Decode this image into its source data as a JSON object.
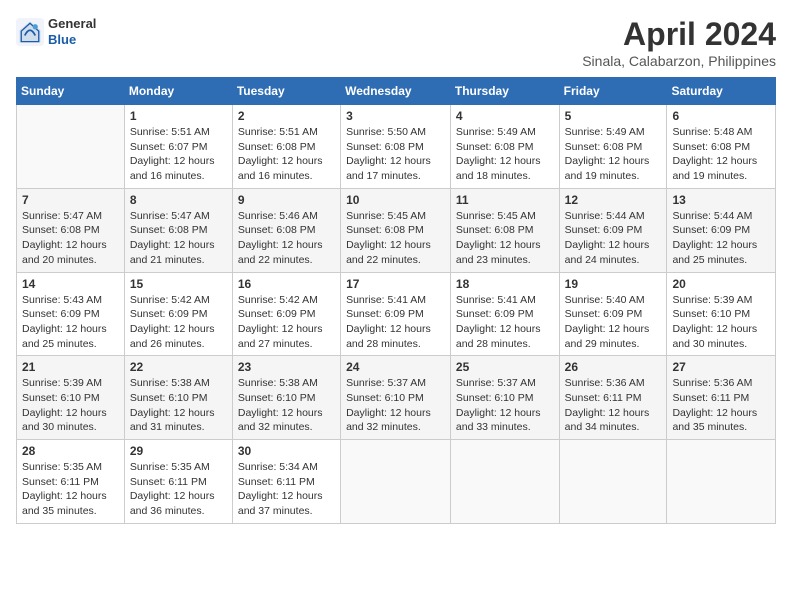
{
  "header": {
    "logo": {
      "general": "General",
      "blue": "Blue"
    },
    "title": "April 2024",
    "subtitle": "Sinala, Calabarzon, Philippines"
  },
  "calendar": {
    "days_of_week": [
      "Sunday",
      "Monday",
      "Tuesday",
      "Wednesday",
      "Thursday",
      "Friday",
      "Saturday"
    ],
    "weeks": [
      [
        {
          "day": "",
          "info": ""
        },
        {
          "day": "1",
          "info": "Sunrise: 5:51 AM\nSunset: 6:07 PM\nDaylight: 12 hours\nand 16 minutes."
        },
        {
          "day": "2",
          "info": "Sunrise: 5:51 AM\nSunset: 6:08 PM\nDaylight: 12 hours\nand 16 minutes."
        },
        {
          "day": "3",
          "info": "Sunrise: 5:50 AM\nSunset: 6:08 PM\nDaylight: 12 hours\nand 17 minutes."
        },
        {
          "day": "4",
          "info": "Sunrise: 5:49 AM\nSunset: 6:08 PM\nDaylight: 12 hours\nand 18 minutes."
        },
        {
          "day": "5",
          "info": "Sunrise: 5:49 AM\nSunset: 6:08 PM\nDaylight: 12 hours\nand 19 minutes."
        },
        {
          "day": "6",
          "info": "Sunrise: 5:48 AM\nSunset: 6:08 PM\nDaylight: 12 hours\nand 19 minutes."
        }
      ],
      [
        {
          "day": "7",
          "info": "Sunrise: 5:47 AM\nSunset: 6:08 PM\nDaylight: 12 hours\nand 20 minutes."
        },
        {
          "day": "8",
          "info": "Sunrise: 5:47 AM\nSunset: 6:08 PM\nDaylight: 12 hours\nand 21 minutes."
        },
        {
          "day": "9",
          "info": "Sunrise: 5:46 AM\nSunset: 6:08 PM\nDaylight: 12 hours\nand 22 minutes."
        },
        {
          "day": "10",
          "info": "Sunrise: 5:45 AM\nSunset: 6:08 PM\nDaylight: 12 hours\nand 22 minutes."
        },
        {
          "day": "11",
          "info": "Sunrise: 5:45 AM\nSunset: 6:08 PM\nDaylight: 12 hours\nand 23 minutes."
        },
        {
          "day": "12",
          "info": "Sunrise: 5:44 AM\nSunset: 6:09 PM\nDaylight: 12 hours\nand 24 minutes."
        },
        {
          "day": "13",
          "info": "Sunrise: 5:44 AM\nSunset: 6:09 PM\nDaylight: 12 hours\nand 25 minutes."
        }
      ],
      [
        {
          "day": "14",
          "info": "Sunrise: 5:43 AM\nSunset: 6:09 PM\nDaylight: 12 hours\nand 25 minutes."
        },
        {
          "day": "15",
          "info": "Sunrise: 5:42 AM\nSunset: 6:09 PM\nDaylight: 12 hours\nand 26 minutes."
        },
        {
          "day": "16",
          "info": "Sunrise: 5:42 AM\nSunset: 6:09 PM\nDaylight: 12 hours\nand 27 minutes."
        },
        {
          "day": "17",
          "info": "Sunrise: 5:41 AM\nSunset: 6:09 PM\nDaylight: 12 hours\nand 28 minutes."
        },
        {
          "day": "18",
          "info": "Sunrise: 5:41 AM\nSunset: 6:09 PM\nDaylight: 12 hours\nand 28 minutes."
        },
        {
          "day": "19",
          "info": "Sunrise: 5:40 AM\nSunset: 6:09 PM\nDaylight: 12 hours\nand 29 minutes."
        },
        {
          "day": "20",
          "info": "Sunrise: 5:39 AM\nSunset: 6:10 PM\nDaylight: 12 hours\nand 30 minutes."
        }
      ],
      [
        {
          "day": "21",
          "info": "Sunrise: 5:39 AM\nSunset: 6:10 PM\nDaylight: 12 hours\nand 30 minutes."
        },
        {
          "day": "22",
          "info": "Sunrise: 5:38 AM\nSunset: 6:10 PM\nDaylight: 12 hours\nand 31 minutes."
        },
        {
          "day": "23",
          "info": "Sunrise: 5:38 AM\nSunset: 6:10 PM\nDaylight: 12 hours\nand 32 minutes."
        },
        {
          "day": "24",
          "info": "Sunrise: 5:37 AM\nSunset: 6:10 PM\nDaylight: 12 hours\nand 32 minutes."
        },
        {
          "day": "25",
          "info": "Sunrise: 5:37 AM\nSunset: 6:10 PM\nDaylight: 12 hours\nand 33 minutes."
        },
        {
          "day": "26",
          "info": "Sunrise: 5:36 AM\nSunset: 6:11 PM\nDaylight: 12 hours\nand 34 minutes."
        },
        {
          "day": "27",
          "info": "Sunrise: 5:36 AM\nSunset: 6:11 PM\nDaylight: 12 hours\nand 35 minutes."
        }
      ],
      [
        {
          "day": "28",
          "info": "Sunrise: 5:35 AM\nSunset: 6:11 PM\nDaylight: 12 hours\nand 35 minutes."
        },
        {
          "day": "29",
          "info": "Sunrise: 5:35 AM\nSunset: 6:11 PM\nDaylight: 12 hours\nand 36 minutes."
        },
        {
          "day": "30",
          "info": "Sunrise: 5:34 AM\nSunset: 6:11 PM\nDaylight: 12 hours\nand 37 minutes."
        },
        {
          "day": "",
          "info": ""
        },
        {
          "day": "",
          "info": ""
        },
        {
          "day": "",
          "info": ""
        },
        {
          "day": "",
          "info": ""
        }
      ]
    ]
  }
}
